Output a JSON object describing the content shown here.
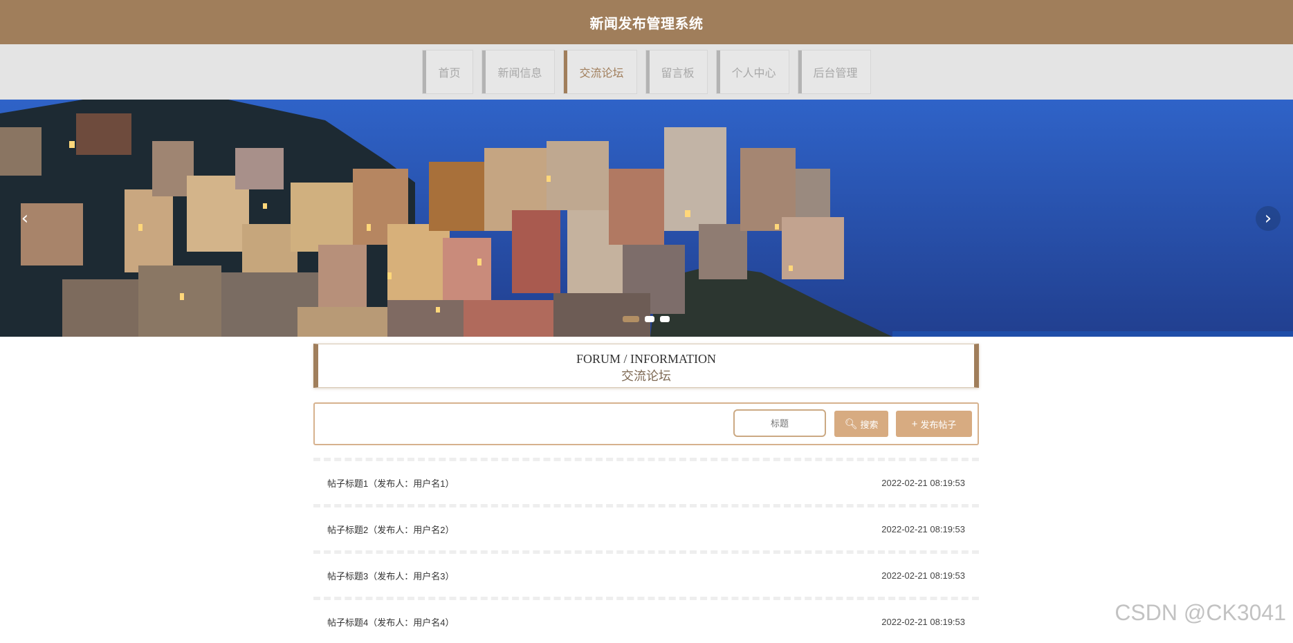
{
  "header": {
    "title": "新闻发布管理系统"
  },
  "nav": {
    "items": [
      {
        "label": "首页"
      },
      {
        "label": "新闻信息"
      },
      {
        "label": "交流论坛"
      },
      {
        "label": "留言板"
      },
      {
        "label": "个人中心"
      },
      {
        "label": "后台管理"
      }
    ],
    "active_index": 2
  },
  "banner": {
    "prev_icon": "chevron-left-icon",
    "next_icon": "chevron-right-icon",
    "slide_count": 3,
    "active_slide": 1
  },
  "section": {
    "title_en": "FORUM / INFORMATION",
    "title_cn": "交流论坛"
  },
  "search": {
    "placeholder": "标题",
    "search_label": "搜索",
    "search_icon": "search-icon",
    "publish_label": "发布帖子",
    "publish_icon": "plus-icon"
  },
  "posts": [
    {
      "title": "帖子标题1（发布人：用户名1）",
      "date": "2022-02-21 08:19:53"
    },
    {
      "title": "帖子标题2（发布人：用户名2）",
      "date": "2022-02-21 08:19:53"
    },
    {
      "title": "帖子标题3（发布人：用户名3）",
      "date": "2022-02-21 08:19:53"
    },
    {
      "title": "帖子标题4（发布人：用户名4）",
      "date": "2022-02-21 08:19:53"
    }
  ],
  "watermark": "CSDN @CK3041",
  "colors": {
    "brand": "#a07e5b",
    "button": "#d7ab81",
    "nav_bg": "#e4e4e4"
  }
}
